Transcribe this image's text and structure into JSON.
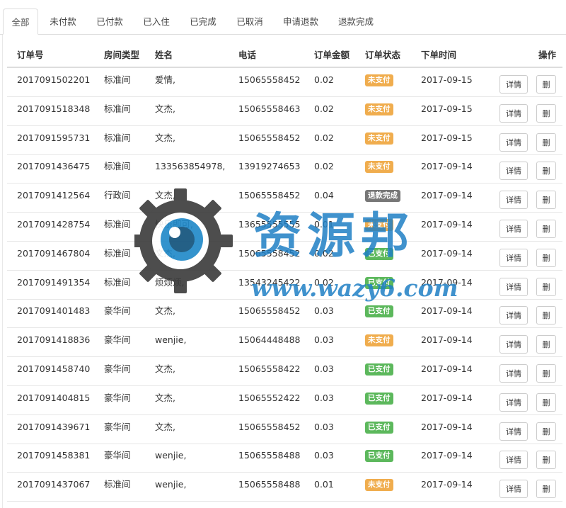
{
  "tabs": [
    {
      "label": "全部",
      "active": true
    },
    {
      "label": "未付款",
      "active": false
    },
    {
      "label": "已付款",
      "active": false
    },
    {
      "label": "已入住",
      "active": false
    },
    {
      "label": "已完成",
      "active": false
    },
    {
      "label": "已取消",
      "active": false
    },
    {
      "label": "申请退款",
      "active": false
    },
    {
      "label": "退款完成",
      "active": false
    }
  ],
  "table": {
    "headers": {
      "order_no": "订单号",
      "room_type": "房间类型",
      "name": "姓名",
      "phone": "电话",
      "amount": "订单金额",
      "status": "订单状态",
      "time": "下单时间",
      "action": "操作"
    },
    "detail_label": "详情",
    "delete_label": "删",
    "status_colors": {
      "未支付": "#f0ad4e",
      "已支付": "#5cb85c",
      "退款完成": "#777777"
    },
    "rows": [
      {
        "order_no": "2017091502201",
        "room_type": "标准间",
        "name": "爱情,",
        "phone": "15065558452",
        "amount": "0.02",
        "status": "未支付",
        "time": "2017-09-15"
      },
      {
        "order_no": "2017091518348",
        "room_type": "标准间",
        "name": "文杰,",
        "phone": "15065558463",
        "amount": "0.02",
        "status": "未支付",
        "time": "2017-09-15"
      },
      {
        "order_no": "2017091595731",
        "room_type": "标准间",
        "name": "文杰,",
        "phone": "15065558452",
        "amount": "0.02",
        "status": "未支付",
        "time": "2017-09-15"
      },
      {
        "order_no": "2017091436475",
        "room_type": "标准间",
        "name": "133563854978,",
        "phone": "13919274653",
        "amount": "0.02",
        "status": "未支付",
        "time": "2017-09-14"
      },
      {
        "order_no": "2017091412564",
        "room_type": "行政间",
        "name": "文杰,",
        "phone": "15065558452",
        "amount": "0.04",
        "status": "退款完成",
        "time": "2017-09-14"
      },
      {
        "order_no": "2017091428754",
        "room_type": "标准间",
        "name": "快乐即可,",
        "phone": "13655555555",
        "amount": "0.01",
        "status": "未支付",
        "time": "2017-09-14"
      },
      {
        "order_no": "2017091467804",
        "room_type": "标准间",
        "name": "文杰,",
        "phone": "15065558452",
        "amount": "0.02",
        "status": "已支付",
        "time": "2017-09-14"
      },
      {
        "order_no": "2017091491354",
        "room_type": "标准间",
        "name": "烦烦烦,",
        "phone": "13543245422",
        "amount": "0.02",
        "status": "已支付",
        "time": "2017-09-14"
      },
      {
        "order_no": "2017091401483",
        "room_type": "豪华间",
        "name": "文杰,",
        "phone": "15065558452",
        "amount": "0.03",
        "status": "已支付",
        "time": "2017-09-14"
      },
      {
        "order_no": "2017091418836",
        "room_type": "豪华间",
        "name": "wenjie,",
        "phone": "15064448488",
        "amount": "0.03",
        "status": "未支付",
        "time": "2017-09-14"
      },
      {
        "order_no": "2017091458740",
        "room_type": "豪华间",
        "name": "文杰,",
        "phone": "15065558422",
        "amount": "0.03",
        "status": "已支付",
        "time": "2017-09-14"
      },
      {
        "order_no": "2017091404815",
        "room_type": "豪华间",
        "name": "文杰,",
        "phone": "15065552422",
        "amount": "0.03",
        "status": "已支付",
        "time": "2017-09-14"
      },
      {
        "order_no": "2017091439671",
        "room_type": "豪华间",
        "name": "文杰,",
        "phone": "15065558452",
        "amount": "0.03",
        "status": "已支付",
        "time": "2017-09-14"
      },
      {
        "order_no": "2017091458381",
        "room_type": "豪华间",
        "name": "wenjie,",
        "phone": "15065558488",
        "amount": "0.03",
        "status": "已支付",
        "time": "2017-09-14"
      },
      {
        "order_no": "2017091437067",
        "room_type": "标准间",
        "name": "wenjie,",
        "phone": "15065558488",
        "amount": "0.01",
        "status": "未支付",
        "time": "2017-09-14"
      }
    ]
  },
  "watermark": {
    "title": "资源邦",
    "url": "www.wazy6.com"
  }
}
